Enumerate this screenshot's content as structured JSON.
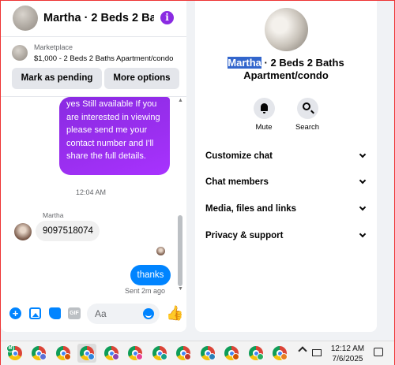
{
  "chat": {
    "title": "Martha · 2 Beds 2 Ba...",
    "listing": {
      "source": "Marketplace",
      "title": "$1,000 - 2 Beds 2 Baths Apartment/condo",
      "mark_pending": "Mark as pending",
      "more_options": "More options"
    },
    "messages": {
      "outgoing_text": "yes Still available If you are interested in viewing please send me your contact number and I'll share the full details.",
      "timestamp": "12:04 AM",
      "sender_name": "Martha",
      "incoming_text": "9097518074",
      "reply_text": "thanks",
      "status": "Sent 2m ago"
    },
    "composer": {
      "placeholder": "Aa",
      "gif_label": "GIF"
    }
  },
  "details": {
    "name_highlight": "Martha",
    "name_rest": " · 2 Beds 2 Baths Apartment/condo",
    "actions": [
      {
        "label": "Mute",
        "icon": "bell-icon"
      },
      {
        "label": "Search",
        "icon": "search-icon"
      }
    ],
    "sections": [
      {
        "label": "Customize chat"
      },
      {
        "label": "Chat members"
      },
      {
        "label": "Media, files and links"
      },
      {
        "label": "Privacy & support"
      }
    ]
  },
  "taskbar": {
    "time": "12:12 AM",
    "date": "7/6/2025",
    "first_badge": "M",
    "badge_colors": [
      "#0f9d58",
      "#5b6fd6",
      "#d35400",
      "#2e86de",
      "#8e44ad",
      "#e84393",
      "#16a085",
      "#c0392b",
      "#2980b9",
      "#d35400",
      "#27ae60",
      "#e67e22",
      "#9b59b6",
      "#34495e",
      "#1abc9c"
    ]
  },
  "colors": {
    "accent_purple": "#8a2be2",
    "messenger_blue": "#0084ff",
    "highlight": "#3366cc"
  }
}
